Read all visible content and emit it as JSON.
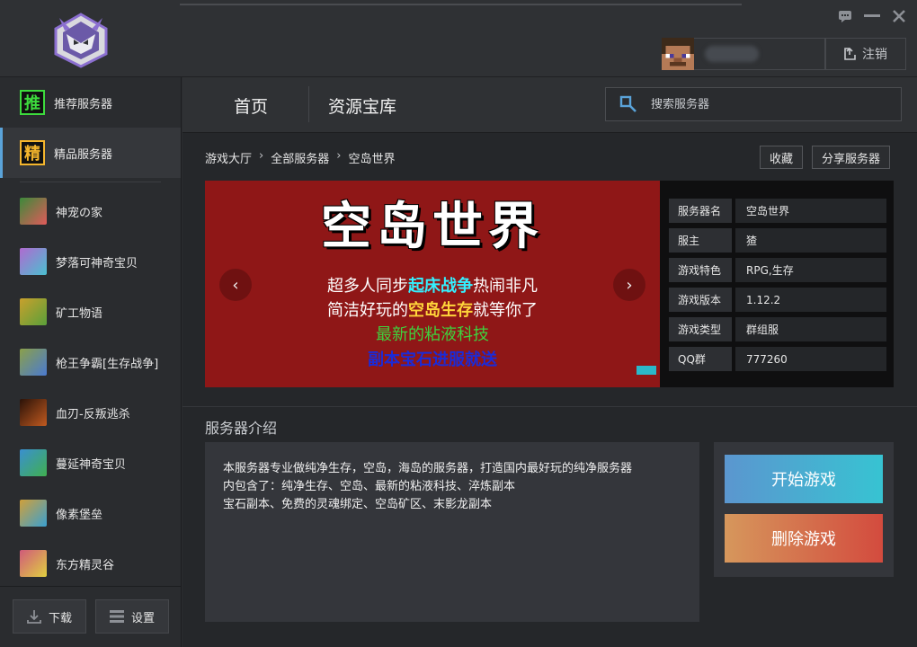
{
  "header": {
    "logout_label": "注销"
  },
  "sidebar": {
    "tabs": [
      {
        "badge": "推",
        "label": "推荐服务器"
      },
      {
        "badge": "精",
        "label": "精品服务器"
      }
    ],
    "servers": [
      {
        "label": "神宠の家",
        "color": "#3c8a3a"
      },
      {
        "label": "梦落可神奇宝贝",
        "color": "#b06ad0"
      },
      {
        "label": "矿工物语",
        "color": "#c9a02c"
      },
      {
        "label": "枪王争霸[生存战争]",
        "color": "#8ba04a"
      },
      {
        "label": "血刃-反叛逃杀",
        "color": "#6a2a16"
      },
      {
        "label": "蔓延神奇宝贝",
        "color": "#3a8fd0"
      },
      {
        "label": "像素堡垒",
        "color": "#d0a03a"
      },
      {
        "label": "东方精灵谷",
        "color": "#d05a7a"
      }
    ],
    "download_label": "下载",
    "settings_label": "设置"
  },
  "nav": {
    "home_label": "首页",
    "resources_label": "资源宝库",
    "search_placeholder": "搜索服务器"
  },
  "breadcrumb": {
    "c1": "游戏大厅",
    "c2": "全部服务器",
    "c3": "空岛世界"
  },
  "actions": {
    "favorite_label": "收藏",
    "share_label": "分享服务器"
  },
  "banner": {
    "title": "空岛世界",
    "line1_a": "超多人同步",
    "line1_hl": "起床战争",
    "line1_b": "热闹非凡",
    "line2_a": "简洁好玩的",
    "line2_hl": "空岛生存",
    "line2_b": "就等你了",
    "line3": "最新的粘液科技",
    "line4": "副本宝石进服就送"
  },
  "info": [
    {
      "key": "服务器名",
      "value": "空岛世界"
    },
    {
      "key": "服主",
      "value": "猹"
    },
    {
      "key": "游戏特色",
      "value": "RPG,生存"
    },
    {
      "key": "游戏版本",
      "value": "1.12.2"
    },
    {
      "key": "游戏类型",
      "value": "群组服"
    },
    {
      "key": "QQ群",
      "value": "777260"
    }
  ],
  "intro": {
    "title": "服务器介绍",
    "line1": "本服务器专业做纯净生存，空岛，海岛的服务器，打造国内最好玩的纯净服务器",
    "line2": "内包含了：纯净生存、空岛、最新的粘液科技、淬炼副本",
    "line3": "宝石副本、免费的灵魂绑定、空岛矿区、末影龙副本"
  },
  "buttons": {
    "start_label": "开始游戏",
    "delete_label": "删除游戏"
  },
  "colors": {
    "accent": "#5aa3d9",
    "banner_bg": "#8f1717"
  }
}
